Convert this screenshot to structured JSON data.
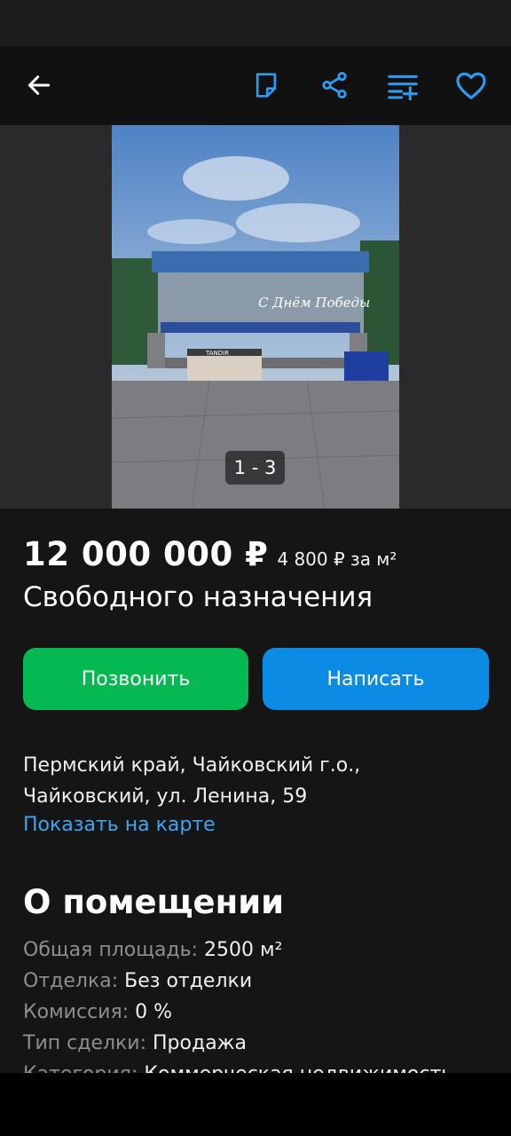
{
  "header": {
    "back_icon": "arrow-left-icon",
    "actions": [
      "note-icon",
      "share-icon",
      "compare-icon",
      "heart-icon"
    ],
    "accent_color": "#2e9bf0"
  },
  "gallery": {
    "counter": "1 - 3",
    "photo_banner_text": "С Днём Победы",
    "photo_sign_text": "TANDIR"
  },
  "listing": {
    "price": "12 000 000 ₽",
    "price_per_m2": "4 800 ₽ за м²",
    "type": "Свободного назначения"
  },
  "buttons": {
    "call": "Позвонить",
    "write": "Написать",
    "call_color": "#04b852",
    "write_color": "#0b8be3"
  },
  "address": {
    "text": "Пермский край, Чайковский г.о., Чайковский, ул. Ленина, 59",
    "map_link": "Показать на карте"
  },
  "about": {
    "title": "О помещении",
    "params": [
      {
        "key": "Общая площадь:",
        "value": "2500 м²"
      },
      {
        "key": "Отделка:",
        "value": "Без отделки"
      },
      {
        "key": "Комиссия:",
        "value": "0 %"
      },
      {
        "key": "Тип сделки:",
        "value": "Продажа"
      },
      {
        "key": "Категория:",
        "value": "Коммерческая недвижимость"
      }
    ]
  }
}
